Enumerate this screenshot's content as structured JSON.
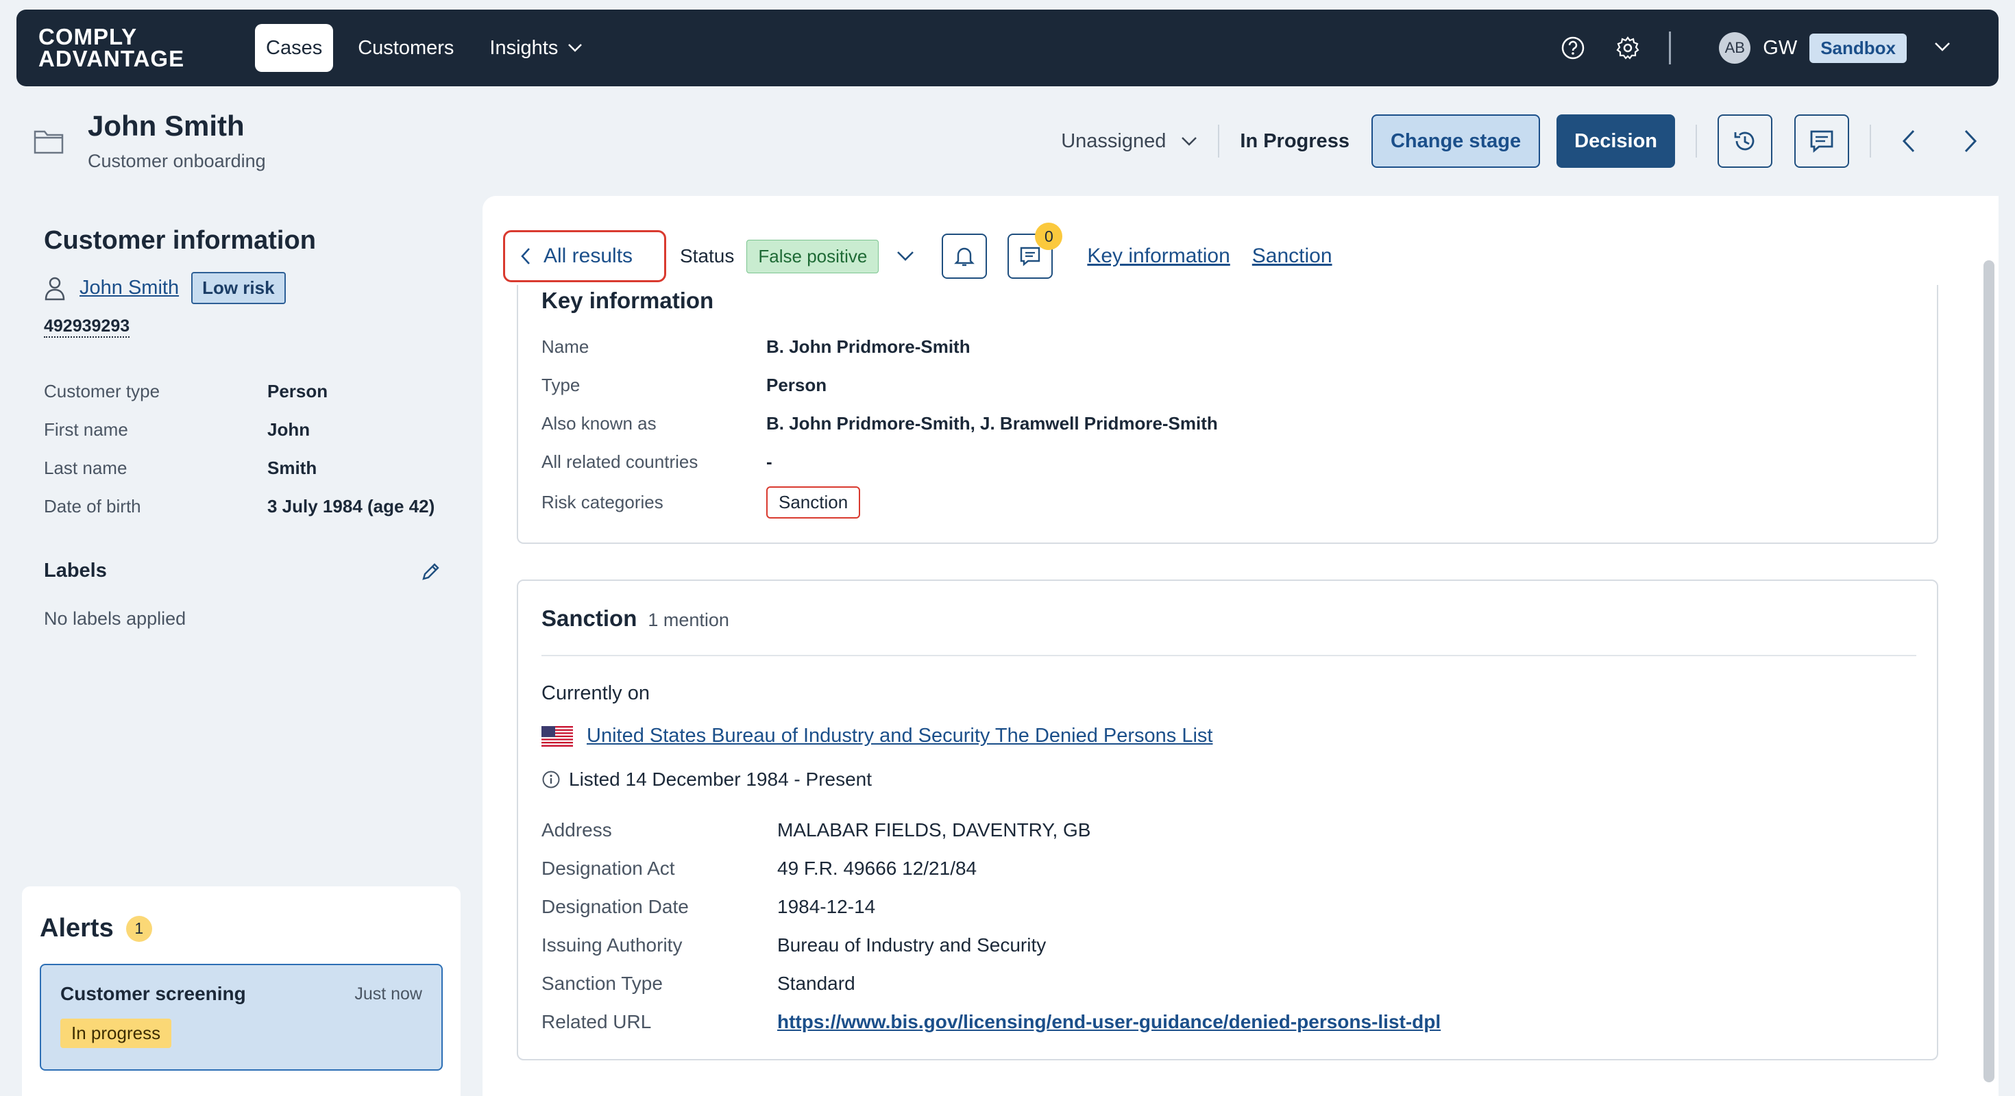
{
  "nav": {
    "logo_line1": "COMPLY",
    "logo_line2": "ADVANTAGE",
    "tabs": [
      {
        "label": "Cases"
      },
      {
        "label": "Customers"
      },
      {
        "label": "Insights"
      }
    ],
    "avatar": "AB",
    "user_initials": "GW",
    "environment": "Sandbox"
  },
  "case": {
    "title": "John Smith",
    "subtitle": "Customer onboarding",
    "assignee": "Unassigned",
    "stage": "In Progress",
    "change_stage_label": "Change stage",
    "decision_label": "Decision"
  },
  "customer": {
    "section_title": "Customer information",
    "name": "John Smith",
    "risk": "Low risk",
    "id": "492939293",
    "fields": [
      {
        "label": "Customer type",
        "value": "Person"
      },
      {
        "label": "First name",
        "value": "John"
      },
      {
        "label": "Last name",
        "value": "Smith"
      },
      {
        "label": "Date of birth",
        "value": "3 July 1984 (age 42)"
      }
    ],
    "labels_title": "Labels",
    "labels_empty": "No labels applied"
  },
  "alerts": {
    "title": "Alerts",
    "count": "1",
    "items": [
      {
        "name": "Customer screening",
        "time": "Just now",
        "status": "In progress"
      }
    ]
  },
  "result": {
    "back_label": "All results",
    "status_label": "Status",
    "status_value": "False positive",
    "comment_count": "0",
    "anchors": [
      "Key information",
      "Sanction"
    ]
  },
  "key_info": {
    "title": "Key information",
    "rows": [
      {
        "label": "Name",
        "value": "B. John Pridmore-Smith"
      },
      {
        "label": "Type",
        "value": "Person"
      },
      {
        "label": "Also known as",
        "value": "B. John Pridmore-Smith, J. Bramwell Pridmore-Smith"
      },
      {
        "label": "All related countries",
        "value": "-"
      },
      {
        "label": "Risk categories",
        "value": "Sanction"
      }
    ]
  },
  "sanction": {
    "title": "Sanction",
    "mentions": "1 mention",
    "currently_on": "Currently on",
    "list_name": "United States Bureau of Industry and Security The Denied Persons List",
    "listed": "Listed 14 December 1984 - Present",
    "details": [
      {
        "label": "Address",
        "value": "MALABAR FIELDS, DAVENTRY, GB"
      },
      {
        "label": "Designation Act",
        "value": "49 F.R. 49666 12/21/84"
      },
      {
        "label": "Designation Date",
        "value": "1984-12-14"
      },
      {
        "label": "Issuing Authority",
        "value": "Bureau of Industry and Security"
      },
      {
        "label": "Sanction Type",
        "value": "Standard"
      },
      {
        "label": "Related URL",
        "value": "https://www.bis.gov/licensing/end-user-guidance/denied-persons-list-dpl"
      }
    ]
  },
  "colors": {
    "nav_bg": "#1b2838",
    "primary": "#1f4f7f",
    "link": "#1b4f8a",
    "highlight_red": "#d93a2f",
    "success_bg": "#c9ecd0",
    "warning": "#fbd876"
  }
}
